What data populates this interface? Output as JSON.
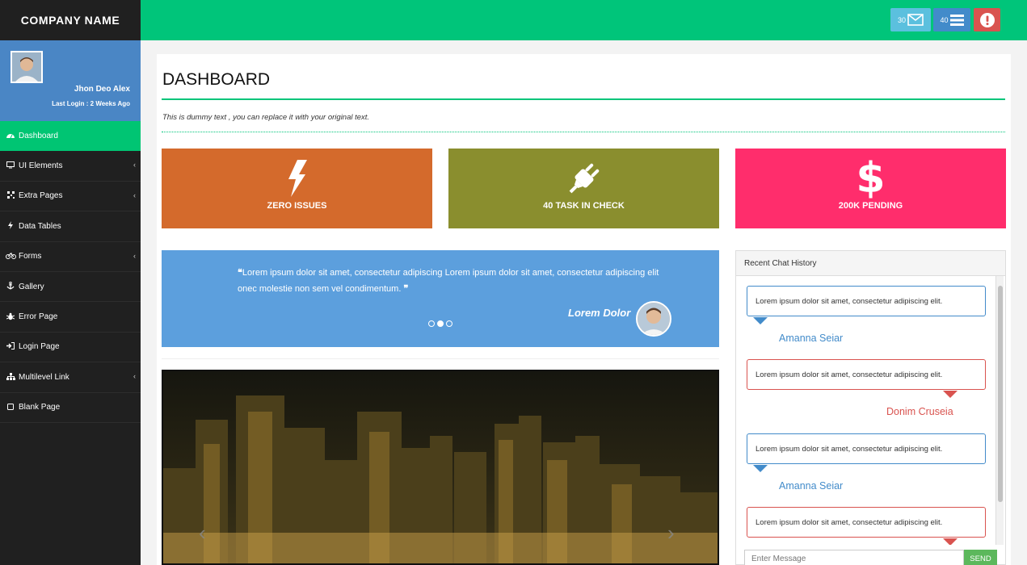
{
  "app": {
    "company_name": "COMPANY NAME"
  },
  "user": {
    "name": "Jhon Deo Alex",
    "last_login": "Last Login : 2 Weeks Ago"
  },
  "sidebar": {
    "items": [
      {
        "label": "Dashboard",
        "icon": "dashboard-icon",
        "active": true,
        "has_caret": false
      },
      {
        "label": "UI Elements",
        "icon": "desktop-icon",
        "active": false,
        "has_caret": true
      },
      {
        "label": "Extra Pages",
        "icon": "qrcode-icon",
        "active": false,
        "has_caret": true
      },
      {
        "label": "Data Tables",
        "icon": "bolt-icon",
        "active": false,
        "has_caret": false
      },
      {
        "label": "Forms",
        "icon": "bicycle-icon",
        "active": false,
        "has_caret": true
      },
      {
        "label": "Gallery",
        "icon": "anchor-icon",
        "active": false,
        "has_caret": false
      },
      {
        "label": "Error Page",
        "icon": "bug-icon",
        "active": false,
        "has_caret": false
      },
      {
        "label": "Login Page",
        "icon": "sign-in-icon",
        "active": false,
        "has_caret": false
      },
      {
        "label": "Multilevel Link",
        "icon": "sitemap-icon",
        "active": false,
        "has_caret": true
      },
      {
        "label": "Blank Page",
        "icon": "square-icon",
        "active": false,
        "has_caret": false
      }
    ]
  },
  "topbar": {
    "mail_count": "30",
    "tasks_count": "40",
    "colors": {
      "mail": "#5bc0de",
      "tasks": "#428bca",
      "alert": "#d9534f"
    }
  },
  "page": {
    "title": "DASHBOARD",
    "subtitle": "This is dummy text , you can replace it with your original text."
  },
  "stats": [
    {
      "label": "ZERO ISSUES",
      "icon": "bolt-icon",
      "color": "#d46a2c"
    },
    {
      "label": "40 TASK IN CHECK",
      "icon": "plug-icon",
      "color": "#8a8e2e"
    },
    {
      "label": "200K PENDING",
      "icon": "dollar-icon",
      "color": "#ff2d6c"
    }
  ],
  "quote": {
    "text": "Lorem ipsum dolor sit amet, consectetur adipiscing Lorem ipsum dolor sit amet, consectetur adipiscing elit onec molestie non sem vel condimentum.",
    "author": "Lorem Dolor",
    "active_dot": 2,
    "dot_count": 3
  },
  "chat": {
    "title": "Recent Chat History",
    "messages": [
      {
        "text": "Lorem ipsum dolor sit amet, consectetur adipiscing elit.",
        "name": "Amanna Seiar",
        "side": "blue"
      },
      {
        "text": "Lorem ipsum dolor sit amet, consectetur adipiscing elit.",
        "name": "Donim Cruseia",
        "side": "red"
      },
      {
        "text": "Lorem ipsum dolor sit amet, consectetur adipiscing elit.",
        "name": "Amanna Seiar",
        "side": "blue"
      },
      {
        "text": "Lorem ipsum dolor sit amet, consectetur adipiscing elit.",
        "name": "",
        "side": "red"
      }
    ],
    "input_placeholder": "Enter Message",
    "send_label": "SEND"
  }
}
